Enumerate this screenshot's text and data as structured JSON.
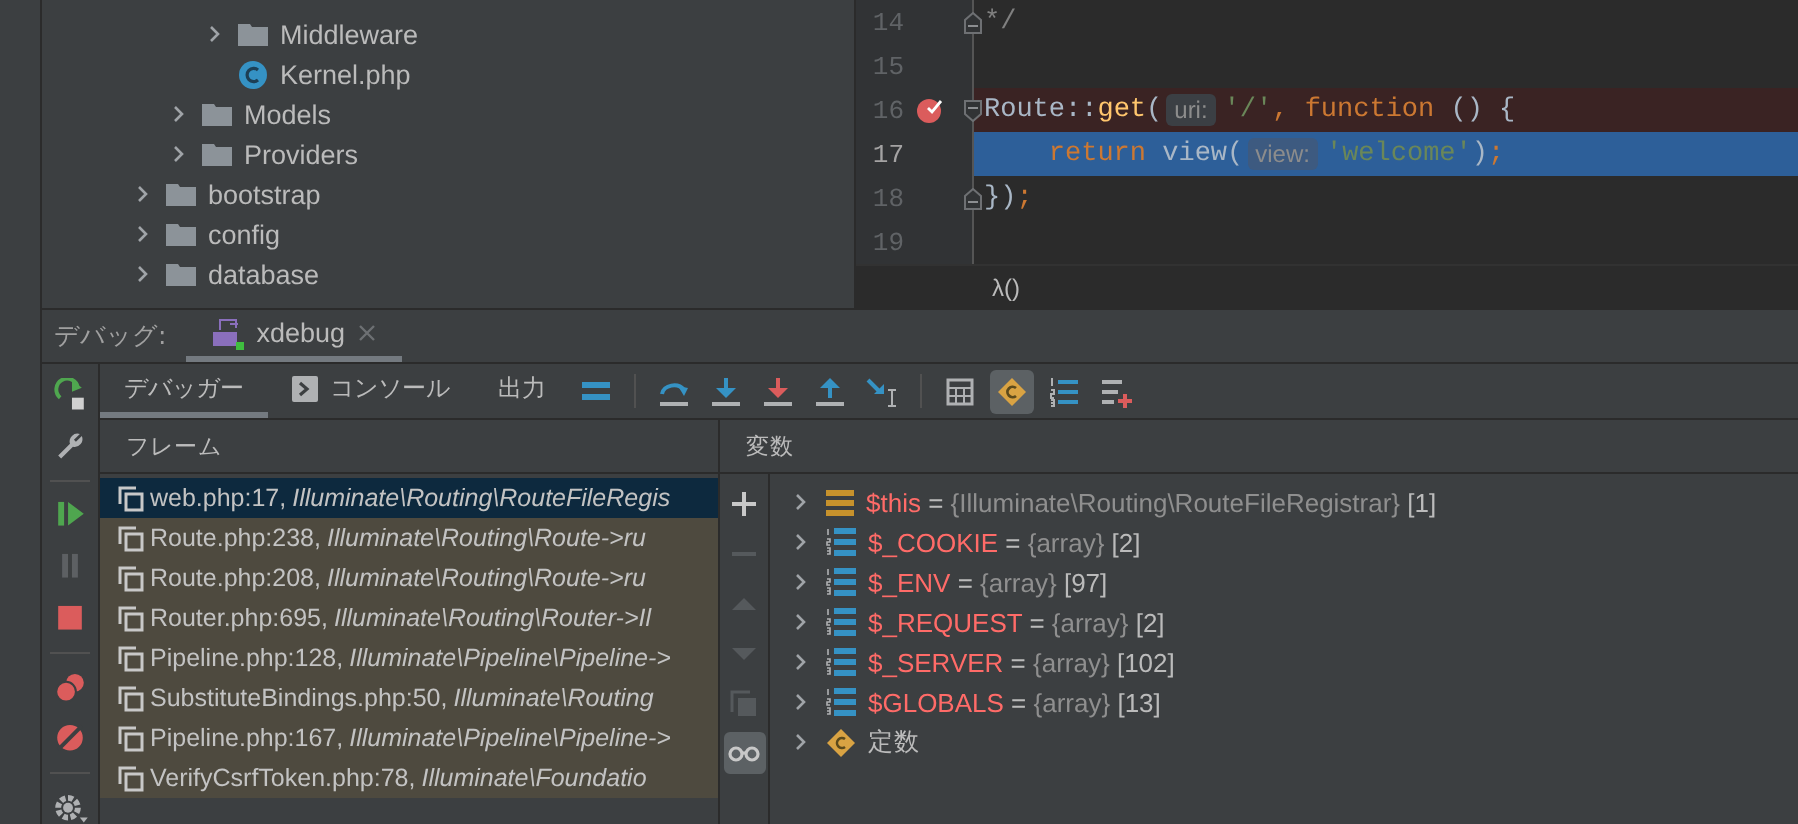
{
  "project_tree": [
    {
      "children": [
        {
          "children": [
            {
              "label": "Middleware",
              "kind": "folder",
              "expanded": false
            },
            {
              "label": "Kernel.php",
              "kind": "php-class"
            }
          ]
        },
        {
          "label": "Models",
          "kind": "folder",
          "expanded": false
        },
        {
          "label": "Providers",
          "kind": "folder",
          "expanded": false
        }
      ]
    },
    {
      "label": "bootstrap",
      "kind": "folder",
      "expanded": false
    },
    {
      "label": "config",
      "kind": "folder",
      "expanded": false
    },
    {
      "label": "database",
      "kind": "folder",
      "expanded": false
    }
  ],
  "editor": {
    "lines": [
      {
        "number": "14",
        "breakpoint": false,
        "current": false,
        "fold_start": false,
        "fold_end": true,
        "tokens": [
          {
            "kind": "comment",
            "text": "*/"
          }
        ]
      },
      {
        "number": "15",
        "breakpoint": false,
        "current": false,
        "fold_start": false,
        "fold_end": false
      },
      {
        "number": "16",
        "breakpoint": true,
        "current": false,
        "fold_start": true,
        "fold_end": false,
        "tokens": [
          {
            "kind": "plain",
            "text": "Route::"
          },
          {
            "kind": "method",
            "text": "get"
          },
          {
            "kind": "plain",
            "text": "("
          },
          {
            "kind": "hint",
            "text": "uri:"
          },
          {
            "kind": "string",
            "text": "'/'"
          },
          {
            "kind": "keyword",
            "text": ", function"
          },
          {
            "kind": "plain",
            "text": " () {"
          }
        ]
      },
      {
        "number": "17",
        "breakpoint": false,
        "current": true,
        "fold_start": false,
        "fold_end": false,
        "tokens": [
          {
            "kind": "keyword",
            "text": "    return"
          },
          {
            "kind": "plain",
            "text": " view("
          },
          {
            "kind": "hint",
            "text": "view:"
          },
          {
            "kind": "string",
            "text": "'welcome'"
          },
          {
            "kind": "plain",
            "text": ")"
          },
          {
            "kind": "keyword",
            "text": ";"
          }
        ]
      },
      {
        "number": "18",
        "breakpoint": false,
        "current": false,
        "fold_start": false,
        "fold_end": true,
        "tokens": [
          {
            "kind": "plain",
            "text": "})"
          },
          {
            "kind": "keyword",
            "text": ";"
          }
        ]
      },
      {
        "number": "19",
        "breakpoint": false,
        "current": false,
        "fold_start": false,
        "fold_end": false
      }
    ],
    "breadcrumb": "λ()"
  },
  "debug": {
    "label": "デバッグ:",
    "session_tab": {
      "label": "xdebug"
    },
    "tabs": [
      {
        "label": "デバッガー",
        "kind": "debugger",
        "selected": true
      },
      {
        "label": "コンソール",
        "kind": "console",
        "selected": false
      },
      {
        "label": "出力",
        "kind": "output",
        "selected": false
      }
    ],
    "toolbar": [
      {
        "kind": "frames-menu"
      },
      {
        "kind": "separator"
      },
      {
        "kind": "step-over"
      },
      {
        "kind": "step-into"
      },
      {
        "kind": "force-step-into"
      },
      {
        "kind": "step-out"
      },
      {
        "kind": "run-to-cursor"
      },
      {
        "kind": "separator"
      },
      {
        "kind": "evaluate"
      },
      {
        "kind": "constants",
        "selected": true
      },
      {
        "kind": "numbered-list"
      },
      {
        "kind": "add-list"
      }
    ],
    "frames": {
      "title": "フレーム",
      "rows": [
        {
          "location": "web.php:17,",
          "method": "Illuminate\\Routing\\RouteFileRegis",
          "selected": true
        },
        {
          "location": "Route.php:238,",
          "method": "Illuminate\\Routing\\Route->ru",
          "selected": false
        },
        {
          "location": "Route.php:208,",
          "method": "Illuminate\\Routing\\Route->ru",
          "selected": false
        },
        {
          "location": "Router.php:695,",
          "method": "Illuminate\\Routing\\Router->Il",
          "selected": false
        },
        {
          "location": "Pipeline.php:128,",
          "method": "Illuminate\\Pipeline\\Pipeline->",
          "selected": false
        },
        {
          "location": "SubstituteBindings.php:50,",
          "method": "Illuminate\\Routing",
          "selected": false
        },
        {
          "location": "Pipeline.php:167,",
          "method": "Illuminate\\Pipeline\\Pipeline->",
          "selected": false
        },
        {
          "location": "VerifyCsrfToken.php:78,",
          "method": "Illuminate\\Foundatio",
          "selected": false
        }
      ]
    },
    "variables": {
      "title": "変数",
      "side_buttons": [
        {
          "kind": "add",
          "disabled": false
        },
        {
          "kind": "remove",
          "disabled": true
        },
        {
          "kind": "up",
          "disabled": true
        },
        {
          "kind": "down",
          "disabled": true
        },
        {
          "kind": "copy",
          "disabled": true
        },
        {
          "kind": "watches",
          "disabled": false,
          "selected": true
        }
      ],
      "rows": [
        {
          "kind": "object",
          "name": "$this",
          "operator": "=",
          "value": "{Illuminate\\Routing\\RouteFileRegistrar}",
          "count": "[1]"
        },
        {
          "kind": "array",
          "name": "$_COOKIE",
          "operator": "=",
          "value": "{array}",
          "count": "[2]"
        },
        {
          "kind": "array",
          "name": "$_ENV",
          "operator": "=",
          "value": "{array}",
          "count": "[97]"
        },
        {
          "kind": "array",
          "name": "$_REQUEST",
          "operator": "=",
          "value": "{array}",
          "count": "[2]"
        },
        {
          "kind": "array",
          "name": "$_SERVER",
          "operator": "=",
          "value": "{array}",
          "count": "[102]"
        },
        {
          "kind": "array",
          "name": "$GLOBALS",
          "operator": "=",
          "value": "{array}",
          "count": "[13]"
        },
        {
          "kind": "constants",
          "name": "定数"
        }
      ]
    }
  }
}
